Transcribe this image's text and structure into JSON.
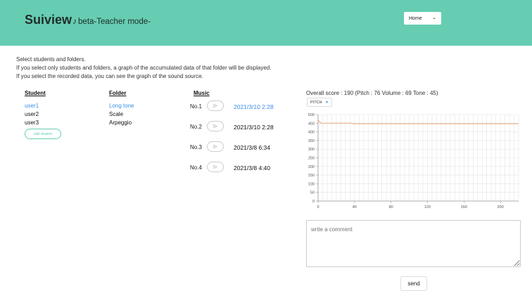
{
  "header": {
    "brand": "Suiview",
    "brand_note": "♪",
    "brand_sub": "beta-Teacher mode-",
    "nav_value": "Home"
  },
  "intro": [
    "Select students and folders.",
    "If you select only students and folders, a graph of the accumulated data of that folder will be displayed.",
    "If you select the recorded data, you can see the graph of the sound source."
  ],
  "columns": {
    "student": "Student",
    "folder": "Folder",
    "music": "Music"
  },
  "students": [
    "user1",
    "user2",
    "user3"
  ],
  "add_student": "add student",
  "folders": [
    "Long tone",
    "Scale",
    "Arpeggio"
  ],
  "music": [
    {
      "no": "No.1",
      "date": "2021/3/10 2:28"
    },
    {
      "no": "No.2",
      "date": "2021/3/10 2:28"
    },
    {
      "no": "No.3",
      "date": "2021/3/8 6:34"
    },
    {
      "no": "No.4",
      "date": "2021/3/8 4:40"
    }
  ],
  "score_text": "Overall score : 190  (Pitch : 76  Volume : 69  Tone : 45)",
  "pitch_select": "PITCH",
  "comment_placeholder": "write a comment",
  "send_label": "send",
  "colors": {
    "header": "#66cdb2",
    "selected": "#3a8ee6",
    "line": "#e8a77a"
  },
  "chart_data": {
    "type": "line",
    "x": [
      0,
      2,
      4,
      6,
      8,
      37,
      38,
      100,
      150,
      200,
      220
    ],
    "series": [
      {
        "values": [
          470,
          455,
          450,
          450,
          450,
          450,
          447,
          447,
          447,
          447,
          447
        ]
      }
    ],
    "xticks": [
      0,
      40,
      80,
      120,
      160,
      200
    ],
    "yticks": [
      0,
      50,
      100,
      150,
      200,
      250,
      300,
      350,
      400,
      450,
      500
    ],
    "xlim": [
      0,
      220
    ],
    "ylim": [
      0,
      500
    ],
    "grid": true
  }
}
